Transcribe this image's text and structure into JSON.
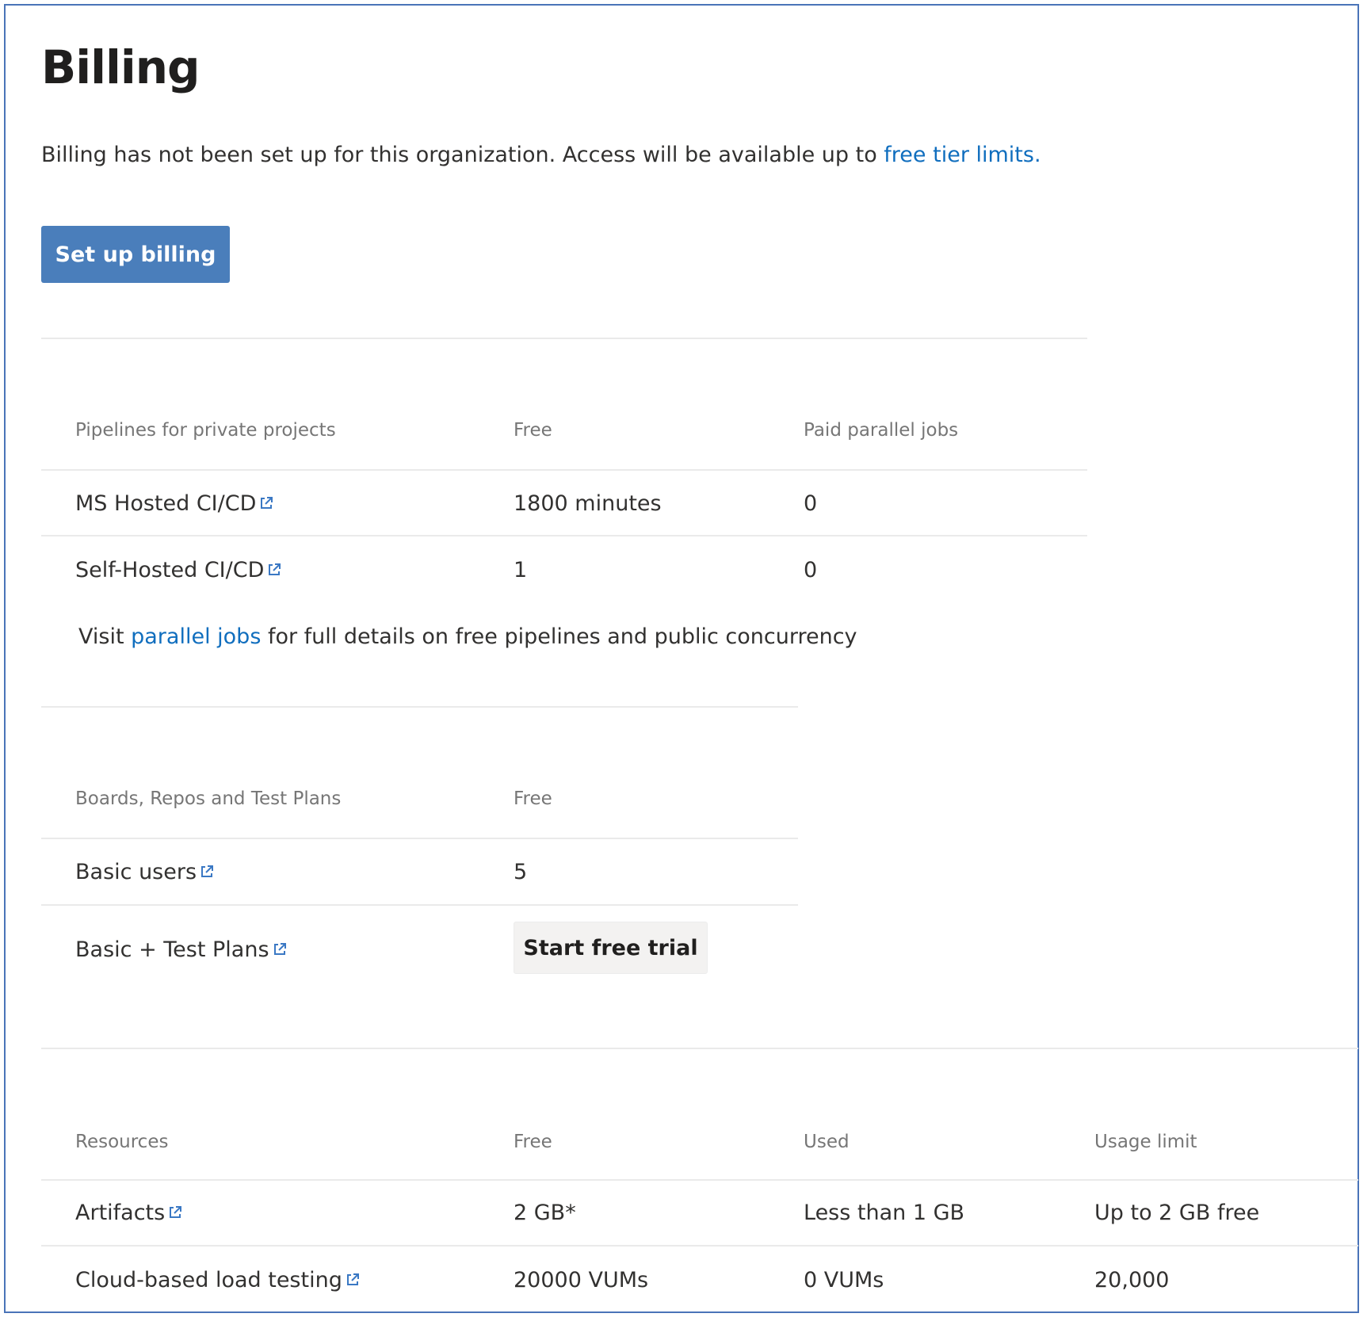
{
  "page": {
    "title": "Billing",
    "intro_text": "Billing has not been set up for this organization. Access will be available up to ",
    "intro_link": "free tier limits.",
    "setup_button": "Set up billing"
  },
  "pipelines": {
    "headers": [
      "Pipelines for private projects",
      "Free",
      "Paid parallel jobs"
    ],
    "rows": [
      {
        "name": "MS Hosted CI/CD",
        "free": "1800 minutes",
        "paid": "0"
      },
      {
        "name": "Self-Hosted CI/CD",
        "free": "1",
        "paid": "0"
      }
    ],
    "note_prefix": "Visit ",
    "note_link": "parallel jobs",
    "note_suffix": " for full details on free pipelines and public concurrency"
  },
  "boards": {
    "headers": [
      "Boards, Repos and Test Plans",
      "Free"
    ],
    "rows": [
      {
        "name": "Basic users",
        "free": "5"
      },
      {
        "name": "Basic + Test Plans"
      }
    ],
    "trial_button": "Start free trial"
  },
  "resources": {
    "headers": [
      "Resources",
      "Free",
      "Used",
      "Usage limit"
    ],
    "rows": [
      {
        "name": "Artifacts",
        "free": "2 GB*",
        "used": "Less than 1 GB",
        "limit": "Up to 2 GB free"
      },
      {
        "name": "Cloud-based load testing",
        "free": "20000 VUMs",
        "used": "0 VUMs",
        "limit": "20,000"
      }
    ]
  },
  "icons": {
    "external_link": "external-link-icon"
  },
  "colors": {
    "accent": "#4a7ebb",
    "link": "#106ebe",
    "frame_border": "#4a74b8"
  }
}
